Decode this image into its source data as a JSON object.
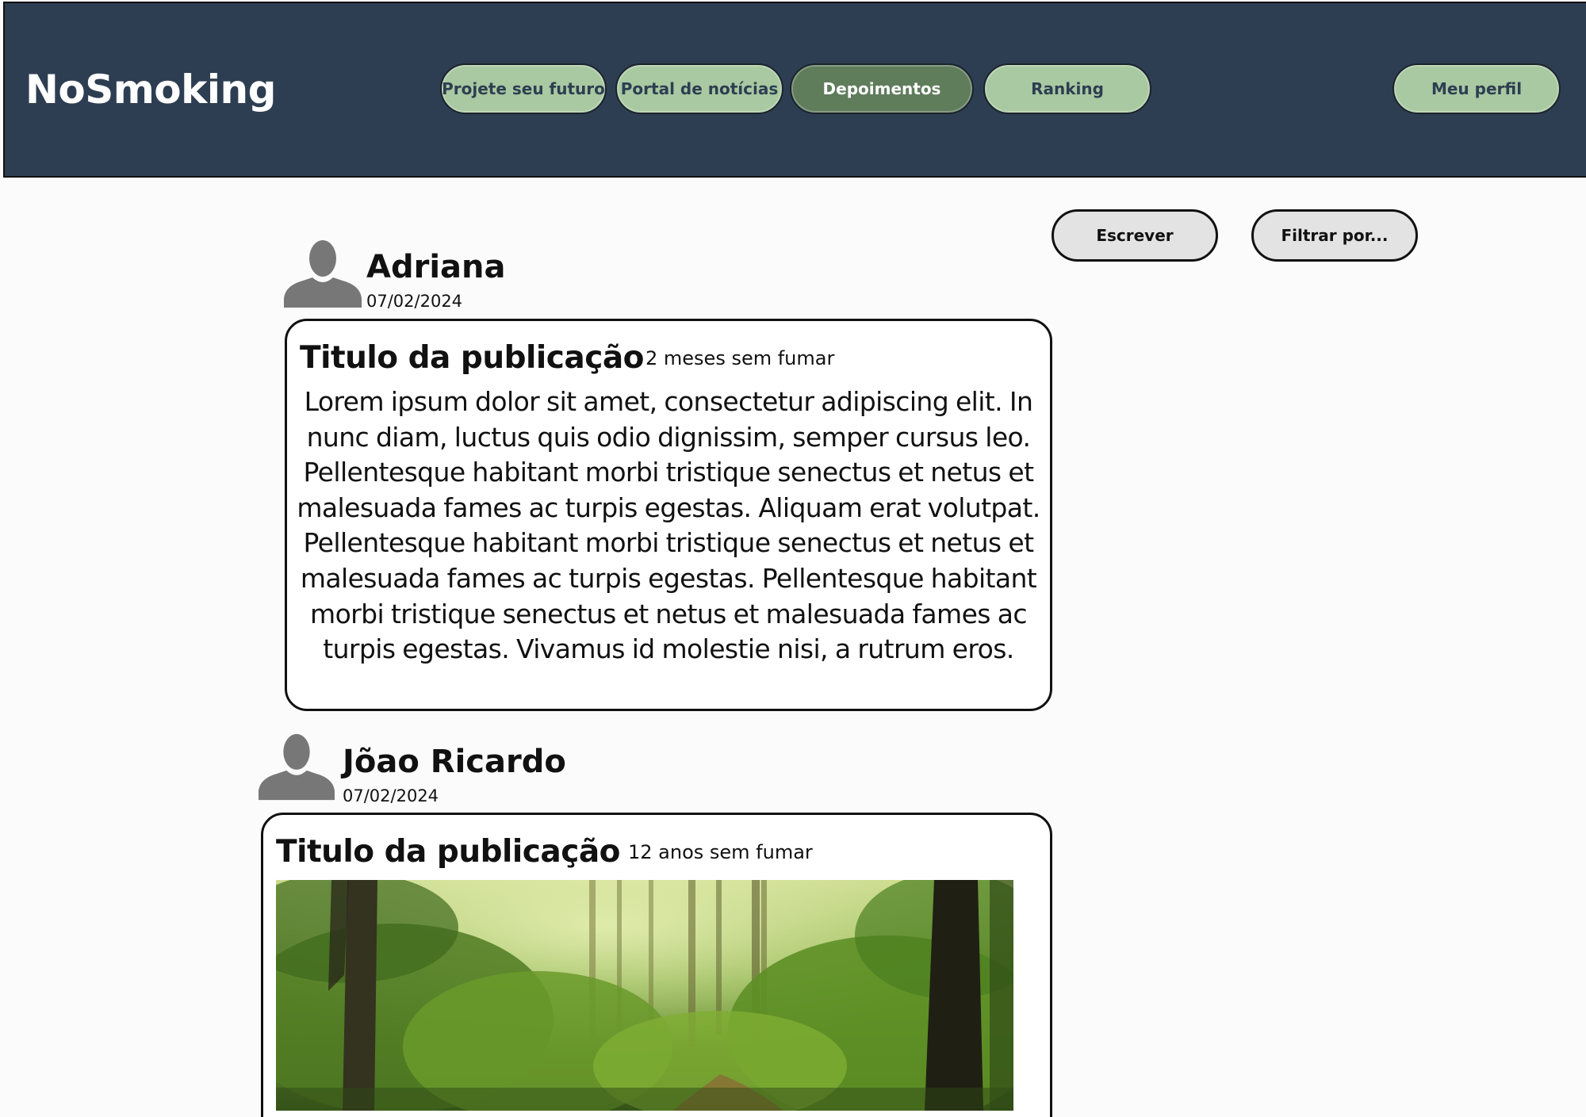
{
  "header": {
    "logo": "NoSmoking",
    "nav": [
      {
        "label": "Projete seu futuro",
        "active": false
      },
      {
        "label": "Portal de notícias",
        "active": false
      },
      {
        "label": "Depoimentos",
        "active": true
      },
      {
        "label": "Ranking",
        "active": false
      }
    ],
    "profile_label": "Meu perfil"
  },
  "actions": {
    "write_label": "Escrever",
    "filter_label": "Filtrar por..."
  },
  "posts": [
    {
      "author": "Adriana",
      "date": "07/02/2024",
      "title": "Titulo da publicação",
      "meta": "2 meses sem fumar",
      "body": "Lorem ipsum dolor sit amet, consectetur adipiscing elit. In nunc diam, luctus quis odio dignissim, semper cursus leo. Pellentesque habitant morbi tristique senectus et netus et malesuada fames ac turpis egestas. Aliquam erat volutpat. Pellentesque habitant morbi tristique senectus et netus et malesuada fames ac turpis egestas. Pellentesque habitant morbi tristique senectus et netus et malesuada fames ac turpis egestas. Vivamus id molestie nisi, a rutrum eros."
    },
    {
      "author": "Jõao Ricardo",
      "date": "07/02/2024",
      "title": "Titulo da publicação",
      "meta": "12 anos sem fumar",
      "image": "forest-photo"
    }
  ],
  "colors": {
    "header_bg": "#2e3e52",
    "nav_bg": "#a8c9a1",
    "nav_active_bg": "#5f7c5b",
    "action_bg": "#e3e3e3",
    "avatar": "#777777"
  }
}
